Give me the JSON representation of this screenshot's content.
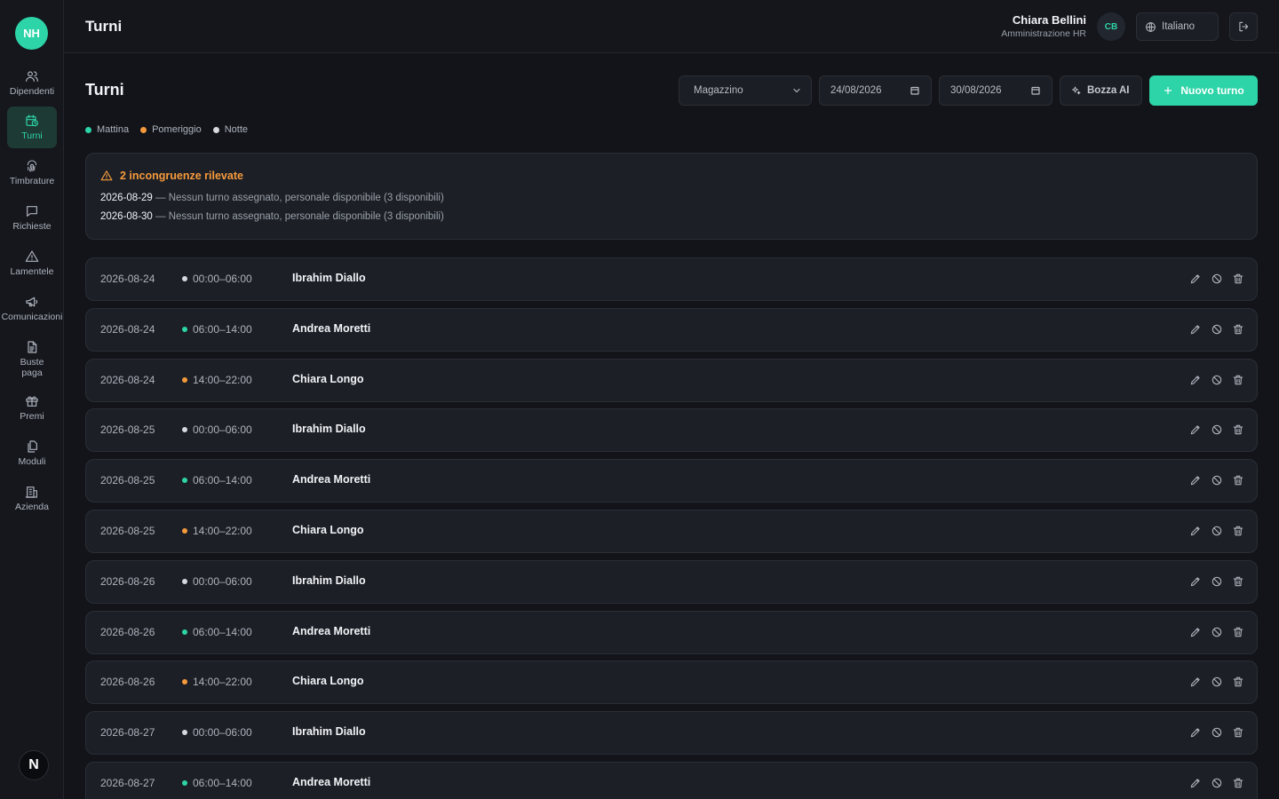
{
  "app": {
    "logo_initials": "NH",
    "bottom_logo": "N"
  },
  "sidebar": {
    "items": [
      {
        "label": "Dipendenti",
        "icon": "users-icon"
      },
      {
        "label": "Turni",
        "icon": "calendar-clock-icon",
        "active": true
      },
      {
        "label": "Timbrature",
        "icon": "fingerprint-icon"
      },
      {
        "label": "Richieste",
        "icon": "message-icon"
      },
      {
        "label": "Lamentele",
        "icon": "warning-icon"
      },
      {
        "label": "Comunicazioni",
        "icon": "megaphone-icon"
      },
      {
        "label": "Buste paga",
        "icon": "document-icon"
      },
      {
        "label": "Premi",
        "icon": "gift-icon"
      },
      {
        "label": "Moduli",
        "icon": "files-icon"
      },
      {
        "label": "Azienda",
        "icon": "building-icon"
      }
    ]
  },
  "header": {
    "title": "Turni",
    "user_name": "Chiara Bellini",
    "user_role": "Amministrazione HR",
    "avatar_initials": "CB",
    "language": "Italiano"
  },
  "main": {
    "title": "Turni",
    "location_select": "Magazzino",
    "date_from": "24/08/2026",
    "date_to": "30/08/2026",
    "ai_button": "Bozza AI",
    "new_button": "Nuovo turno"
  },
  "legend": [
    {
      "label": "Mattina",
      "color": "#2dd4a7"
    },
    {
      "label": "Pomeriggio",
      "color": "#f59a3c"
    },
    {
      "label": "Notte",
      "color": "#d6d9df"
    }
  ],
  "alert": {
    "title": "2 incongruenze rilevate",
    "items": [
      {
        "date": "2026-08-29",
        "text": " — Nessun turno assegnato, personale disponibile (3 disponibili)"
      },
      {
        "date": "2026-08-30",
        "text": " — Nessun turno assegnato, personale disponibile (3 disponibili)"
      }
    ]
  },
  "colors": {
    "accent": "#2dd4a7",
    "warning": "#f59a3c",
    "night": "#d6d9df"
  },
  "shifts": [
    {
      "date": "2026-08-24",
      "time": "00:00–06:00",
      "type": "night",
      "name": "Ibrahim Diallo"
    },
    {
      "date": "2026-08-24",
      "time": "06:00–14:00",
      "type": "morning",
      "name": "Andrea Moretti"
    },
    {
      "date": "2026-08-24",
      "time": "14:00–22:00",
      "type": "afternoon",
      "name": "Chiara Longo"
    },
    {
      "date": "2026-08-25",
      "time": "00:00–06:00",
      "type": "night",
      "name": "Ibrahim Diallo"
    },
    {
      "date": "2026-08-25",
      "time": "06:00–14:00",
      "type": "morning",
      "name": "Andrea Moretti"
    },
    {
      "date": "2026-08-25",
      "time": "14:00–22:00",
      "type": "afternoon",
      "name": "Chiara Longo"
    },
    {
      "date": "2026-08-26",
      "time": "00:00–06:00",
      "type": "night",
      "name": "Ibrahim Diallo"
    },
    {
      "date": "2026-08-26",
      "time": "06:00–14:00",
      "type": "morning",
      "name": "Andrea Moretti"
    },
    {
      "date": "2026-08-26",
      "time": "14:00–22:00",
      "type": "afternoon",
      "name": "Chiara Longo"
    },
    {
      "date": "2026-08-27",
      "time": "00:00–06:00",
      "type": "night",
      "name": "Ibrahim Diallo"
    },
    {
      "date": "2026-08-27",
      "time": "06:00–14:00",
      "type": "morning",
      "name": "Andrea Moretti"
    }
  ]
}
